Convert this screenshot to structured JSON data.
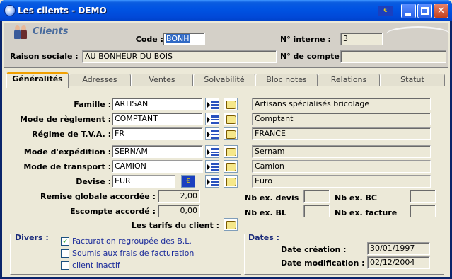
{
  "window": {
    "title": "Les clients - DEMO",
    "flag_text": "€"
  },
  "header": {
    "section_title": "Clients",
    "code_label": "Code :",
    "code_value": "BONH",
    "interne_label": "N° interne :",
    "interne_value": "3",
    "raison_label": "Raison sociale :",
    "raison_value": "AU BONHEUR DU BOIS",
    "compte_label": "N° de compte :",
    "compte_value": ""
  },
  "tabs": [
    "Généralités",
    "Adresses",
    "Ventes",
    "Solvabilité",
    "Bloc notes",
    "Relations",
    "Statut"
  ],
  "form": {
    "rows": [
      {
        "label": "Famille :",
        "value": "ARTISAN",
        "desc": "Artisans spécialisés bricolage"
      },
      {
        "label": "Mode de règlement :",
        "value": "COMPTANT",
        "desc": "Comptant"
      },
      {
        "label": "Régime de T.V.A. :",
        "value": "FR",
        "desc": "FRANCE"
      },
      {
        "label": "Mode d'expédition :",
        "value": "SERNAM",
        "desc": "Sernam"
      },
      {
        "label": "Mode de transport :",
        "value": "CAMION",
        "desc": "Camion"
      },
      {
        "label": "Devise :",
        "value": "EUR",
        "desc": "Euro"
      }
    ],
    "remise_label": "Remise globale accordée :",
    "remise_value": "2,00",
    "escompte_label": "Escompte accordé :",
    "escompte_value": "0,00",
    "tarifs_label": "Les tarifs du client :",
    "nb_devis_label": "Nb ex. devis",
    "nb_devis_value": "",
    "nb_bc_label": "Nb ex. BC",
    "nb_bc_value": "",
    "nb_bl_label": "Nb ex. BL",
    "nb_bl_value": "",
    "nb_facture_label": "Nb ex. facture",
    "nb_facture_value": ""
  },
  "divers": {
    "title": "Divers :",
    "options": [
      {
        "label": "Facturation regroupée des B.L.",
        "checked": true
      },
      {
        "label": "Soumis aux frais de facturation",
        "checked": false
      },
      {
        "label": "client inactif",
        "checked": false
      }
    ]
  },
  "dates": {
    "title": "Dates :",
    "creation_label": "Date création :",
    "creation_value": "30/01/1997",
    "modif_label": "Date modification :",
    "modif_value": "02/12/2004"
  }
}
